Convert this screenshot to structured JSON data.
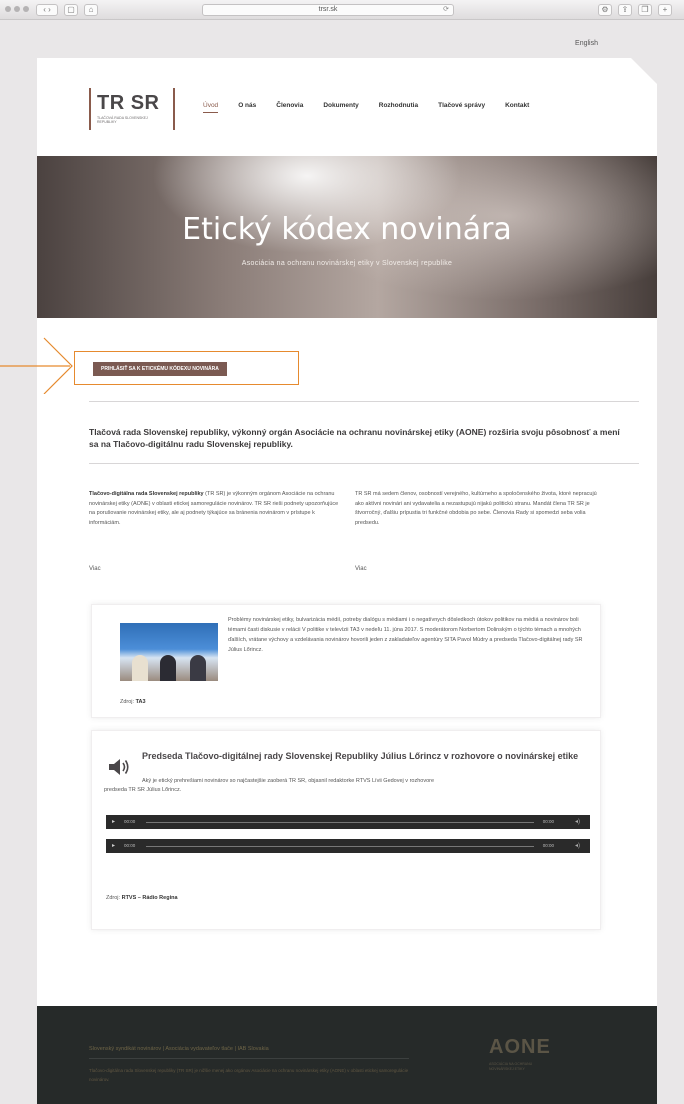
{
  "browser": {
    "url": "trsr.sk"
  },
  "lang_switch": "English",
  "logo": {
    "text": "TR SR",
    "subtitle": "Tlačová rada Slovenskej republiky"
  },
  "nav": [
    "Úvod",
    "O nás",
    "Členovia",
    "Dokumenty",
    "Rozhodnutia",
    "Tlačové správy",
    "Kontakt"
  ],
  "hero": {
    "title": "Etický kódex novinára",
    "subtitle": "Asociácia na ochranu novinárskej etiky v Slovenskej republike"
  },
  "cta": "PRIHLÁSIŤ SA K ETICKÉMU KÓDEXU NOVINÁRA",
  "lead": "Tlačová rada Slovenskej republiky, výkonný orgán Asociácie na ochranu novinárskej etiky (AONE) rozširia svoju pôsobnosť a mení sa na Tlačovo-digitálnu radu Slovenskej republiky.",
  "col1": {
    "strong": "Tlačovo-digitálna rada Slovenskej republiky",
    "text": " (TR SR) je výkonným orgánom Asociácie na ochranu novinárskej etiky (AONE) v oblasti etickej samoregulácie novinárov. TR SR rieši podnety upozorňujúce na porušovanie novinárskej etiky, ale aj podnety týkajúce sa bránenia novinárom v prístupe k informáciám.",
    "more": "Viac"
  },
  "col2": {
    "text": "TR SR má sedem členov, osobností verejného, kultúrneho a spoločenského života, ktoré nepracujú ako aktívni novinári ani vydavatelia a nezastupujú nijakú politickú stranu. Mandát člena TR SR je štvorročný, ďalšiu prípustia tri funkčné obdobia po sebe. Členovia Rady si spomedzi seba volia predsedu.",
    "more": "Viac"
  },
  "video": {
    "text": "Problémy novinárskej etiky, bulvarizácia médií, potreby dialógu s médiami i o negatívnych dôsledkoch útokov politikov na médiá a novinárov boli témami časti diskusie v relácii V politike v televízii TA3 v nedeľu 11. júna 2017. S moderátorom Norbertom Dolinským o týchto témach a mnohých ďalších, vrátane výchovy a vzdelávania novinárov hovorili jeden z zakladateľov agentúry SITA Pavol Múdry a predseda Tlačovo-digitálnej rady SR Július Lőrincz.",
    "source_label": "Zdroj: ",
    "source": "TA3"
  },
  "audio": {
    "title": "Predseda Tlačovo-digitálnej rady Slovenskej Republiky Július Lőrincz v rozhovore o novinárskej etike",
    "desc": "Aký je etický prehrešiami novinárov so najčastejšie zaoberá TR SR, objasnil redaktorke RTVS Lívii Gedovej v rozhovore",
    "desc2": "predseda TR SR Július Lőrincz.",
    "time_start": "00:00",
    "time_end": "00:00",
    "source_label": "Zdroj: ",
    "source": "RTVS – Rádio Regina"
  },
  "footer": {
    "links": "Slovenský syndikát novinárov  |  Asociácia vydavateľov tlače  |  IAB Slovakia",
    "text": "Tlačovo-digitálna rada Slovenskej republiky (TR SR) je nižšie menej ako orgánov Asociácie na ochranu novinárskej etiky (AONE) v oblasti etickej samoregulácie novinárov.",
    "aone": "AONE",
    "aone_sub": "Asociácia na ochranu novinárskej etiky"
  }
}
